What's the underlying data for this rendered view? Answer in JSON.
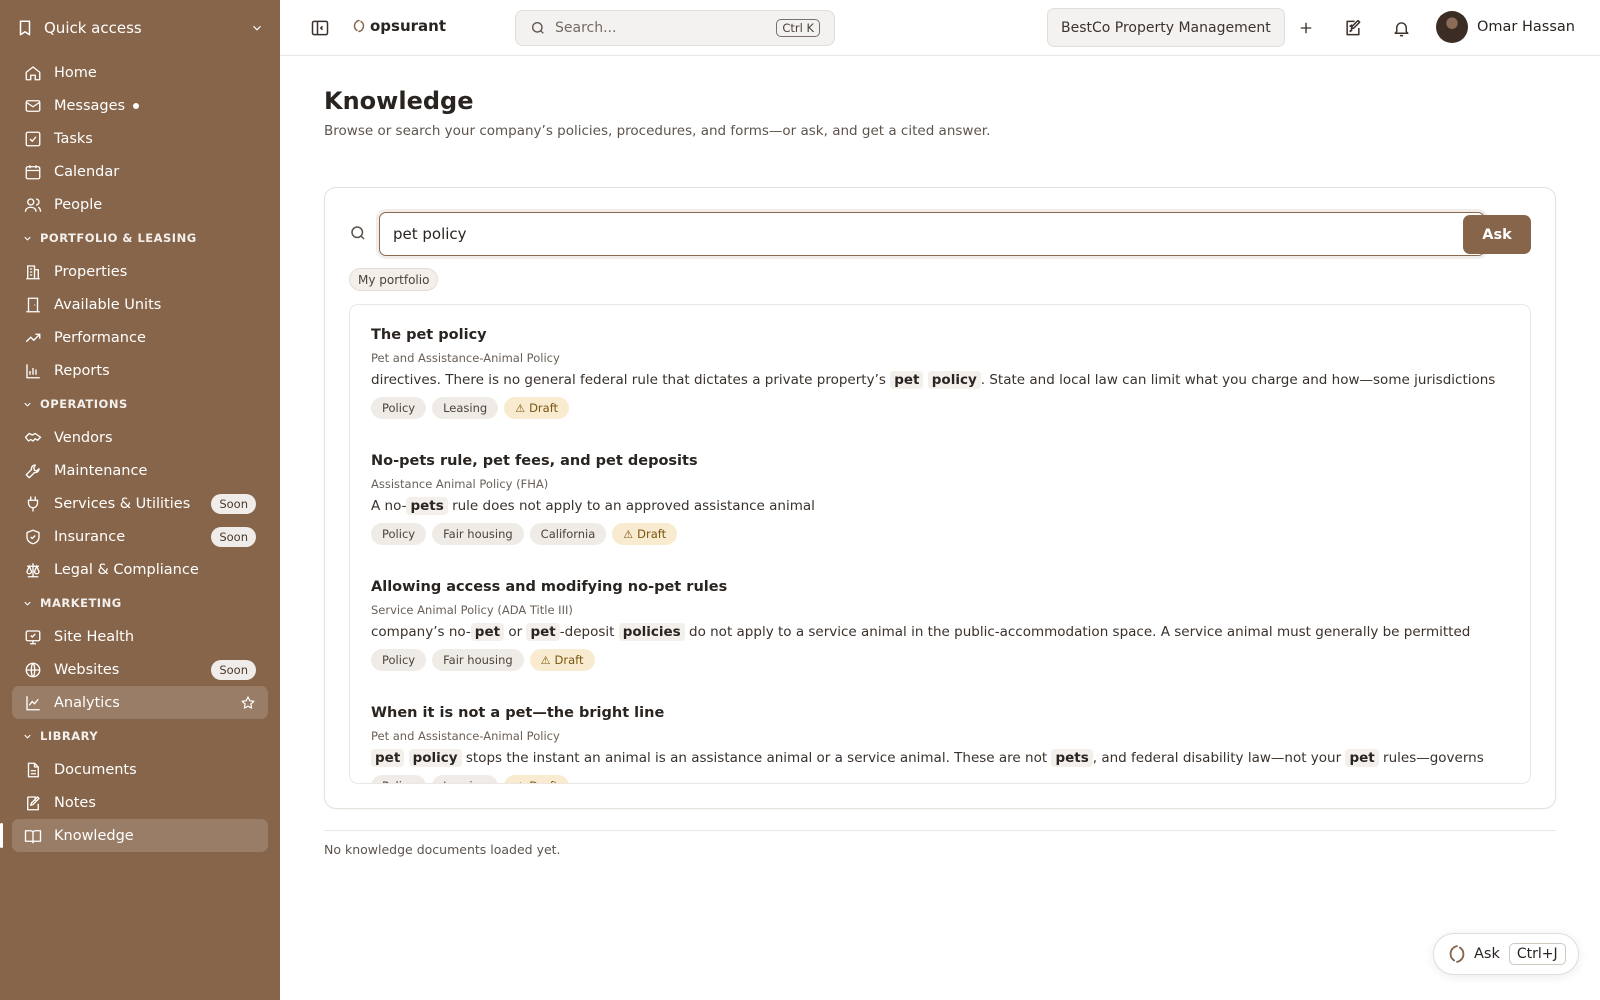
{
  "sidebar": {
    "quick_access": "Quick access",
    "top_items": [
      {
        "label": "Home"
      },
      {
        "label": "Messages"
      },
      {
        "label": "Tasks"
      },
      {
        "label": "Calendar"
      },
      {
        "label": "People"
      }
    ],
    "sections": [
      {
        "title": "PORTFOLIO & LEASING",
        "items": [
          {
            "label": "Properties"
          },
          {
            "label": "Available Units"
          },
          {
            "label": "Performance"
          },
          {
            "label": "Reports"
          }
        ]
      },
      {
        "title": "OPERATIONS",
        "items": [
          {
            "label": "Vendors"
          },
          {
            "label": "Maintenance"
          },
          {
            "label": "Services & Utilities",
            "badge": "Soon"
          },
          {
            "label": "Insurance",
            "badge": "Soon"
          },
          {
            "label": "Legal & Compliance"
          }
        ]
      },
      {
        "title": "MARKETING",
        "items": [
          {
            "label": "Site Health"
          },
          {
            "label": "Websites",
            "badge": "Soon"
          },
          {
            "label": "Analytics"
          }
        ]
      },
      {
        "title": "LIBRARY",
        "items": [
          {
            "label": "Documents"
          },
          {
            "label": "Notes"
          },
          {
            "label": "Knowledge"
          }
        ]
      }
    ]
  },
  "topbar": {
    "brand": "opsurant",
    "search_placeholder": "Search...",
    "search_shortcut": "Ctrl K",
    "org": "BestCo Property Management",
    "user_name": "Omar Hassan"
  },
  "page": {
    "title": "Knowledge",
    "subtitle": "Browse or search your company’s policies, procedures, and forms—or ask, and get a cited answer.",
    "query": "pet policy",
    "ask_button": "Ask",
    "scope_chip": "My portfolio",
    "empty_note": "No knowledge documents loaded yet."
  },
  "results": [
    {
      "title": "The pet policy",
      "source": "Pet and Assistance-Animal Policy",
      "snippet_parts": [
        {
          "t": "directives. There is no general federal rule that dictates a private property’s "
        },
        {
          "t": "pet",
          "hl": true
        },
        {
          "t": " "
        },
        {
          "t": "policy",
          "hl": true
        },
        {
          "t": ". State and local law can limit what you charge and how—some jurisdictions"
        }
      ],
      "tags": [
        {
          "label": "Policy"
        },
        {
          "label": "Leasing"
        },
        {
          "label": "Draft",
          "draft": true
        }
      ]
    },
    {
      "title": "No-pets rule, pet fees, and pet deposits",
      "source": "Assistance Animal Policy (FHA)",
      "snippet_parts": [
        {
          "t": "A no-"
        },
        {
          "t": "pets",
          "hl": true
        },
        {
          "t": " rule does not apply to an approved assistance animal"
        }
      ],
      "tags": [
        {
          "label": "Policy"
        },
        {
          "label": "Fair housing"
        },
        {
          "label": "California"
        },
        {
          "label": "Draft",
          "draft": true
        }
      ]
    },
    {
      "title": "Allowing access and modifying no-pet rules",
      "source": "Service Animal Policy (ADA Title III)",
      "snippet_parts": [
        {
          "t": "company’s no-"
        },
        {
          "t": "pet",
          "hl": true
        },
        {
          "t": " or "
        },
        {
          "t": "pet",
          "hl": true
        },
        {
          "t": "-deposit "
        },
        {
          "t": "policies",
          "hl": true
        },
        {
          "t": " do not apply to a service animal in the public-accommodation space. A service animal must generally be permitted"
        }
      ],
      "tags": [
        {
          "label": "Policy"
        },
        {
          "label": "Fair housing"
        },
        {
          "label": "Draft",
          "draft": true
        }
      ]
    },
    {
      "title": "When it is not a pet—the bright line",
      "source": "Pet and Assistance-Animal Policy",
      "snippet_parts": [
        {
          "t": "pet",
          "hl": true
        },
        {
          "t": " "
        },
        {
          "t": "policy",
          "hl": true
        },
        {
          "t": " stops the instant an animal is an assistance animal or a service animal. These are not "
        },
        {
          "t": "pets",
          "hl": true
        },
        {
          "t": ", and federal disability law—not your "
        },
        {
          "t": "pet",
          "hl": true
        },
        {
          "t": " rules—governs"
        }
      ],
      "tags": [
        {
          "label": "Policy"
        },
        {
          "label": "Leasing"
        },
        {
          "label": "Draft",
          "draft": true
        }
      ]
    }
  ],
  "fab": {
    "label": "Ask",
    "shortcut": "Ctrl+J"
  },
  "colors": {
    "sidebar_bg": "#86654a",
    "accent": "#86654a",
    "draft_bg": "#f8ebcf",
    "draft_text": "#7a5512"
  }
}
